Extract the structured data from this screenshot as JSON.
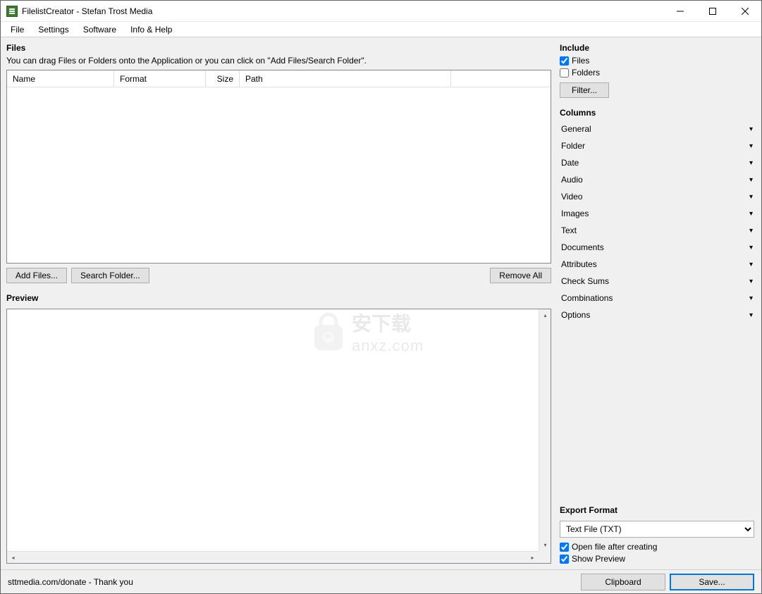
{
  "window": {
    "title": "FilelistCreator - Stefan Trost Media"
  },
  "menu": {
    "items": [
      "File",
      "Settings",
      "Software",
      "Info & Help"
    ]
  },
  "files_section": {
    "heading": "Files",
    "hint": "You can drag Files or Folders onto the Application or you can click on \"Add Files/Search Folder\".",
    "columns": {
      "name": "Name",
      "format": "Format",
      "size": "Size",
      "path": "Path"
    },
    "add_files_btn": "Add Files...",
    "search_folder_btn": "Search Folder...",
    "remove_all_btn": "Remove All"
  },
  "preview_section": {
    "heading": "Preview"
  },
  "include_section": {
    "heading": "Include",
    "files_label": "Files",
    "files_checked": true,
    "folders_label": "Folders",
    "folders_checked": false,
    "filter_btn": "Filter..."
  },
  "columns_section": {
    "heading": "Columns",
    "groups": [
      "General",
      "Folder",
      "Date",
      "Audio",
      "Video",
      "Images",
      "Text",
      "Documents",
      "Attributes",
      "Check Sums",
      "Combinations",
      "Options"
    ]
  },
  "export_section": {
    "heading": "Export Format",
    "selected": "Text File (TXT)",
    "open_after_label": "Open file after creating",
    "open_after_checked": true,
    "show_preview_label": "Show Preview",
    "show_preview_checked": true
  },
  "bottom": {
    "status": "sttmedia.com/donate - Thank you",
    "clipboard_btn": "Clipboard",
    "save_btn": "Save..."
  },
  "watermark": {
    "text": "安下载",
    "url": "anxz.com"
  }
}
